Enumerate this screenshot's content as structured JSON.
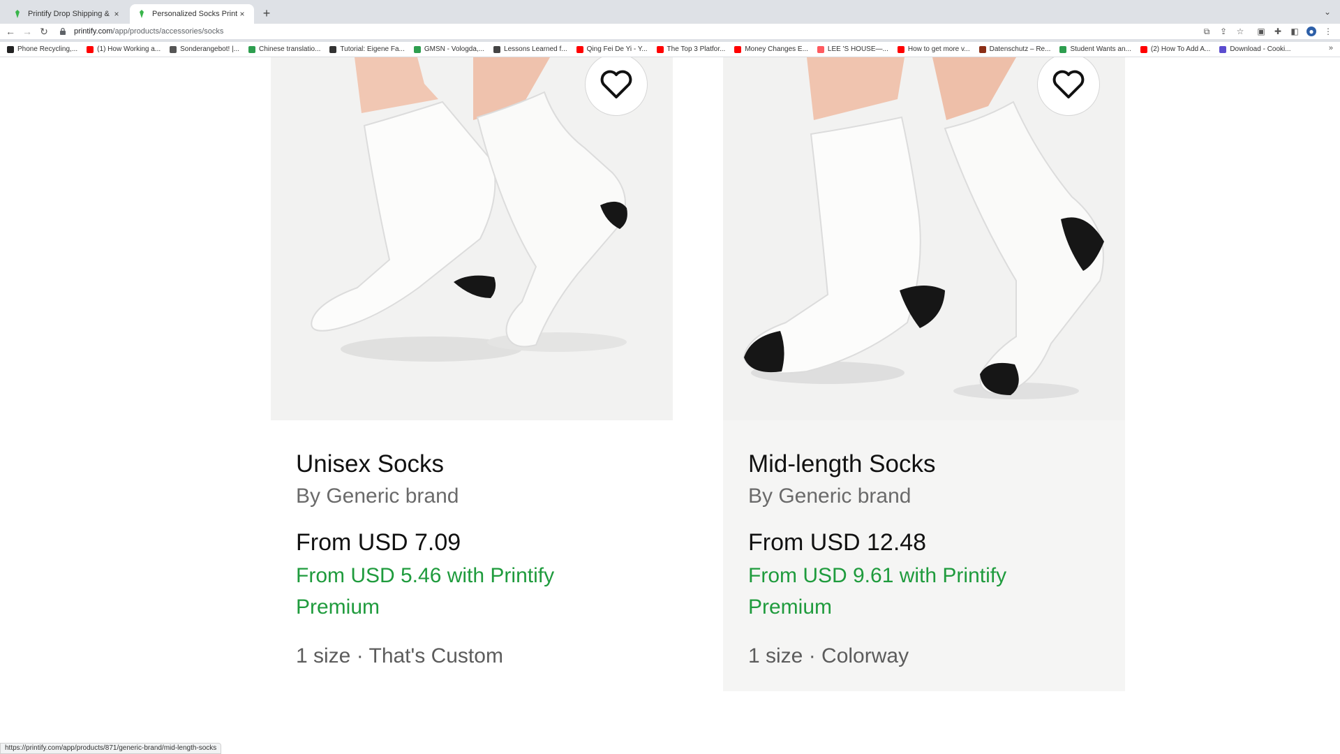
{
  "browser": {
    "tabs": [
      {
        "title": "Printify Drop Shipping & Printi"
      },
      {
        "title": "Personalized Socks Print on De"
      }
    ],
    "new_tab_symbol": "+",
    "close_symbol": "×",
    "url_domain": "printify.com",
    "url_path": "/app/products/accessories/socks",
    "bookmarks": [
      {
        "label": "Phone Recycling,...",
        "color": "#222222"
      },
      {
        "label": "(1) How Working a...",
        "color": "#ff0000"
      },
      {
        "label": "Sonderangebot! |...",
        "color": "#555555"
      },
      {
        "label": "Chinese translatio...",
        "color": "#2e9e4f"
      },
      {
        "label": "Tutorial: Eigene Fa...",
        "color": "#333333"
      },
      {
        "label": "GMSN - Vologda,...",
        "color": "#2e9e4f"
      },
      {
        "label": "Lessons Learned f...",
        "color": "#444444"
      },
      {
        "label": "Qing Fei De Yi - Y...",
        "color": "#ff0000"
      },
      {
        "label": "The Top 3 Platfor...",
        "color": "#ff0000"
      },
      {
        "label": "Money Changes E...",
        "color": "#ff0000"
      },
      {
        "label": "LEE 'S HOUSE—...",
        "color": "#ff5a5f"
      },
      {
        "label": "How to get more v...",
        "color": "#ff0000"
      },
      {
        "label": "Datenschutz – Re...",
        "color": "#8b2e16"
      },
      {
        "label": "Student Wants an...",
        "color": "#2e9e4f"
      },
      {
        "label": "(2) How To Add A...",
        "color": "#ff0000"
      },
      {
        "label": "Download - Cooki...",
        "color": "#5b4ccf"
      }
    ],
    "bookmarks_more": "»",
    "status_url": "https://printify.com/app/products/871/generic-brand/mid-length-socks"
  },
  "products": [
    {
      "title": "Unisex Socks",
      "brand": "By Generic brand",
      "price": "From USD 7.09",
      "premium_line1": "From USD 5.46 with Printify",
      "premium_line2": "Premium",
      "meta": "1 size · That's Custom"
    },
    {
      "title": "Mid-length Socks",
      "brand": "By Generic brand",
      "price": "From USD 12.48",
      "premium_line1": "From USD 9.61 with Printify",
      "premium_line2": "Premium",
      "meta": "1 size · Colorway"
    }
  ],
  "colors": {
    "premium_green": "#1f9b3d",
    "printify_favicon": "#39b54a"
  }
}
